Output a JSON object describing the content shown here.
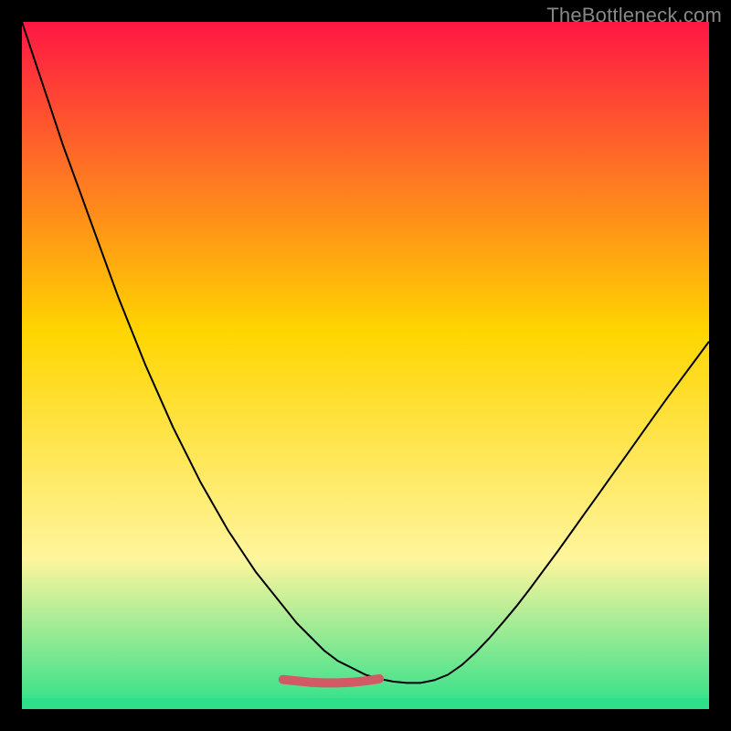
{
  "watermark": "TheBottleneck.com",
  "colors": {
    "frame": "#000000",
    "watermark": "#888888",
    "curve_stroke": "#000000",
    "highlight": "#d15a64",
    "baseline": "#2fe08a",
    "gradient_top": "#ff1744",
    "gradient_mid": "#ffd500",
    "gradient_yellow_light": "#fff59d",
    "gradient_bottom": "#2fe08a"
  },
  "chart_data": {
    "type": "line",
    "title": "",
    "xlabel": "",
    "ylabel": "",
    "xlim": [
      0,
      100
    ],
    "ylim": [
      0,
      100
    ],
    "x": [
      0,
      2,
      4,
      6,
      8,
      10,
      12,
      14,
      16,
      18,
      20,
      22,
      24,
      26,
      28,
      30,
      32,
      34,
      36,
      38,
      40,
      42,
      44,
      46,
      48,
      50,
      52,
      54,
      56,
      58,
      60,
      62,
      64,
      66,
      68,
      70,
      72,
      74,
      76,
      78,
      80,
      82,
      84,
      86,
      88,
      90,
      92,
      94,
      96,
      98,
      100
    ],
    "values": [
      100,
      94,
      88,
      82,
      76.5,
      71,
      65.5,
      60,
      55,
      50,
      45.5,
      41,
      37,
      33,
      29.5,
      26,
      23,
      20,
      17.5,
      15,
      12.5,
      10.5,
      8.5,
      7,
      6,
      5,
      4.4,
      4,
      3.8,
      3.8,
      4.2,
      5,
      6.4,
      8.2,
      10.3,
      12.6,
      15,
      17.6,
      20.3,
      23,
      25.8,
      28.6,
      31.4,
      34.2,
      37,
      39.8,
      42.6,
      45.4,
      48.1,
      50.8,
      53.5
    ],
    "highlight_segment_x": [
      38,
      40,
      42,
      44,
      46,
      48,
      50,
      52
    ],
    "highlight_segment_values": [
      4.3,
      4.1,
      3.9,
      3.8,
      3.8,
      3.9,
      4.1,
      4.4
    ]
  }
}
